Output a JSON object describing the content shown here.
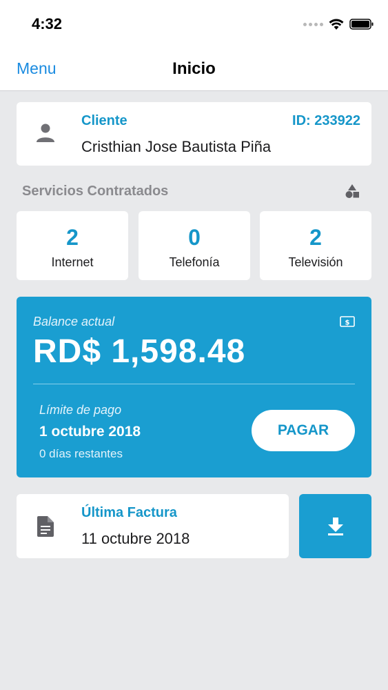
{
  "status_bar": {
    "time": "4:32",
    "icons": [
      "signal-dots-icon",
      "wifi-icon",
      "battery-icon"
    ]
  },
  "nav": {
    "menu_label": "Menu",
    "title": "Inicio"
  },
  "client": {
    "label": "Cliente",
    "id": "ID: 233922",
    "name": "Cristhian Jose Bautista Piña",
    "icon": "person-icon"
  },
  "services": {
    "title": "Servicios Contratados",
    "icon": "shapes-icon",
    "items": [
      {
        "count": "2",
        "label": "Internet"
      },
      {
        "count": "0",
        "label": "Telefonía"
      },
      {
        "count": "2",
        "label": "Televisión"
      }
    ]
  },
  "balance": {
    "label": "Balance actual",
    "amount": "RD$ 1,598.48",
    "icon": "money-icon",
    "limit_label": "Límite de pago",
    "limit_date": "1 octubre 2018",
    "days_left": "0 días restantes",
    "pay_label": "PAGAR"
  },
  "invoice": {
    "label": "Última Factura",
    "date": "11 octubre 2018",
    "icon": "document-icon",
    "download_icon": "download-icon"
  },
  "colors": {
    "accent": "#1596c9",
    "balance_bg": "#1a9ed1",
    "nav_link": "#1a8be0",
    "background": "#e8e9eb"
  }
}
